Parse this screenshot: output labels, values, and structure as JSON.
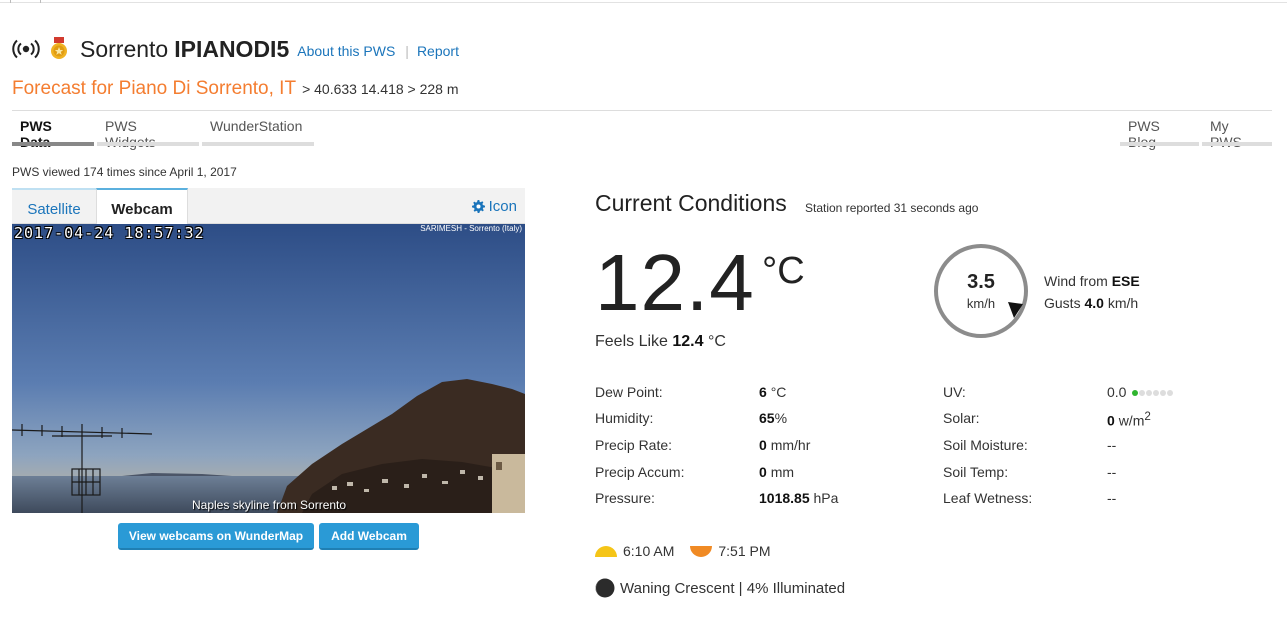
{
  "header": {
    "station_prefix": "Sorrento",
    "station_id": "IPIANODI5",
    "about_link": "About this PWS",
    "separator": "|",
    "report_link": "Report"
  },
  "forecast": {
    "link_text": "Forecast for Piano Di Sorrento, IT",
    "coords_text": "> 40.633 14.418 > 228 m"
  },
  "nav": {
    "left_tabs": [
      {
        "label": "PWS Data",
        "active": true
      },
      {
        "label": "PWS Widgets",
        "active": false
      },
      {
        "label": "WunderStation",
        "active": false
      }
    ],
    "right_tabs": [
      {
        "label": "PWS Blog"
      },
      {
        "label": "My PWS"
      }
    ]
  },
  "viewed_text": "PWS viewed 174 times since April 1, 2017",
  "webcam": {
    "tabs": [
      "Satellite",
      "Webcam"
    ],
    "active_tab": "Webcam",
    "icon_link": "Icon",
    "timestamp": "2017-04-24 18:57:32",
    "credit": "SARIMESH - Sorrento (Italy)",
    "caption": "Naples skyline from Sorrento",
    "buttons": {
      "wundermap": "View webcams on WunderMap",
      "add": "Add Webcam"
    }
  },
  "current": {
    "title": "Current Conditions",
    "reported": "Station reported 31 seconds ago",
    "temperature": "12.4",
    "temp_unit": "°C",
    "feels_label": "Feels Like",
    "feels_value": "12.4",
    "feels_unit": "°C",
    "wind": {
      "speed": "3.5",
      "unit": "km/h",
      "from_label": "Wind from",
      "direction": "ESE",
      "gusts_label": "Gusts",
      "gusts_value": "4.0",
      "gusts_unit": "km/h"
    },
    "left_stats": [
      {
        "label": "Dew Point:",
        "value": "6",
        "unit": "°C"
      },
      {
        "label": "Humidity:",
        "value": "65",
        "unit": "%"
      },
      {
        "label": "Precip Rate:",
        "value": "0",
        "unit": "mm/hr"
      },
      {
        "label": "Precip Accum:",
        "value": "0",
        "unit": "mm"
      },
      {
        "label": "Pressure:",
        "value": "1018.85",
        "unit": "hPa"
      }
    ],
    "right_stats": [
      {
        "label": "UV:",
        "value": "0.0",
        "unit": ""
      },
      {
        "label": "Solar:",
        "value": "0",
        "unit": "w/m",
        "sup": "2"
      },
      {
        "label": "Soil Moisture:",
        "value": "--",
        "unit": ""
      },
      {
        "label": "Soil Temp:",
        "value": "--",
        "unit": ""
      },
      {
        "label": "Leaf Wetness:",
        "value": "--",
        "unit": ""
      }
    ],
    "uv_level": 1,
    "uv_max": 6
  },
  "astro": {
    "sunrise": "6:10 AM",
    "sunset": "7:51 PM",
    "moon": "Waning Crescent | 4% Illuminated"
  },
  "colors": {
    "link": "#1b75bb",
    "forecast": "#f47d30",
    "button": "#2a9ad6",
    "uv_on": "#2fb52f",
    "sunrise": "#f5c518",
    "sunset": "#f08a24"
  }
}
